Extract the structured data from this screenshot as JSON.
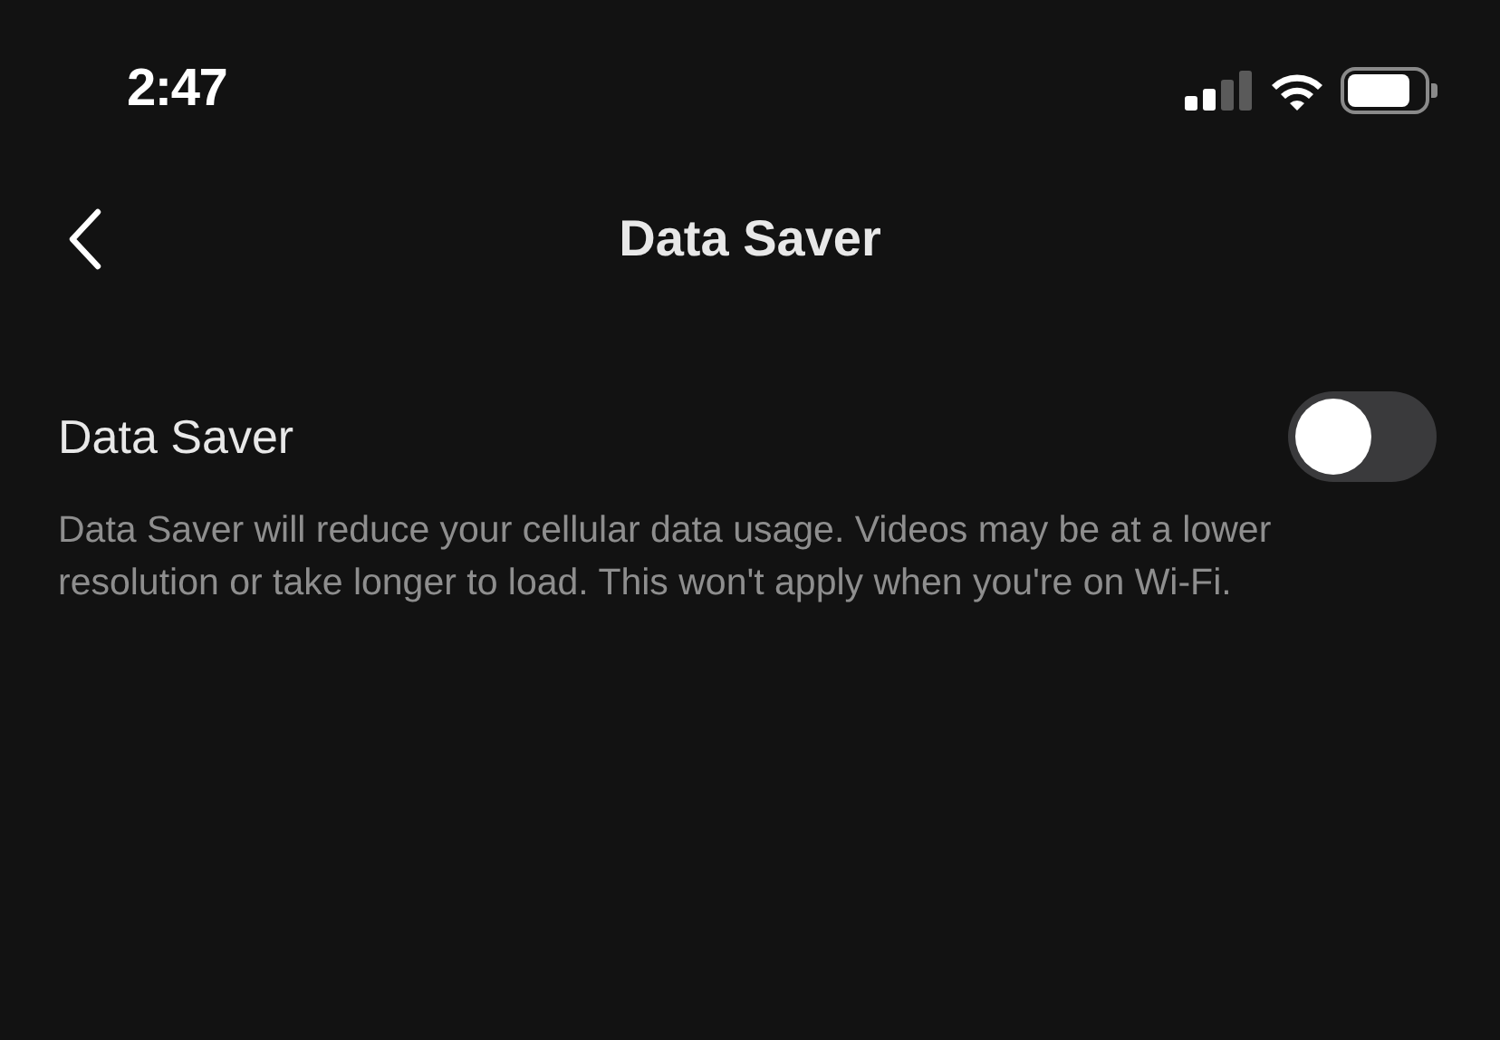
{
  "status_bar": {
    "time": "2:47"
  },
  "header": {
    "title": "Data Saver"
  },
  "setting": {
    "label": "Data Saver",
    "on": false,
    "description": "Data Saver will reduce your cellular data usage. Videos may be at a lower resolution or take longer to load. This won't apply when you're on Wi-Fi."
  }
}
